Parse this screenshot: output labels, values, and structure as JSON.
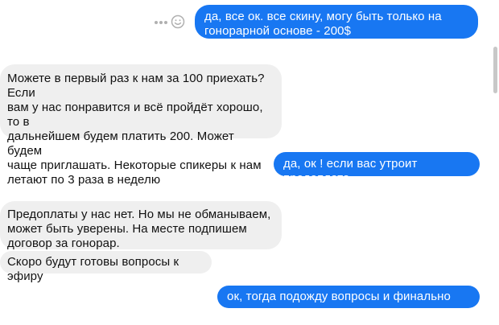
{
  "messages": [
    {
      "direction": "out",
      "text": "да, все ок. все скину, могу быть только на\nгонорарной основе - 200$"
    },
    {
      "direction": "in",
      "text": "Можете в первый раз к нам за 100 приехать? Если\nвам у нас понравится и всё пройдёт хорошо, то в\nдальнейшем будем платить 200. Может будем\nчаще приглашать. Некоторые спикеры к нам\nлетают по 3 раза в неделю"
    },
    {
      "direction": "out",
      "text": "да, ок ! если вас утроит предоплата"
    },
    {
      "direction": "in",
      "text": "Предоплаты у нас нет. Но мы не обманываем,\nможет быть уверены. На месте подпишем\nдоговор за гонорар."
    },
    {
      "direction": "in",
      "text": "Скоро будут готовы вопросы к эфиру"
    },
    {
      "direction": "out",
      "text": "ок, тогда подожду вопросы и финально отвечу"
    }
  ],
  "icons": {
    "more": "more-dots-icon",
    "react": "emoji-smile-icon"
  },
  "colors": {
    "outgoing_bubble": "#1877f2",
    "incoming_bubble": "#efefef",
    "outgoing_text": "#ffffff",
    "incoming_text": "#111111"
  }
}
